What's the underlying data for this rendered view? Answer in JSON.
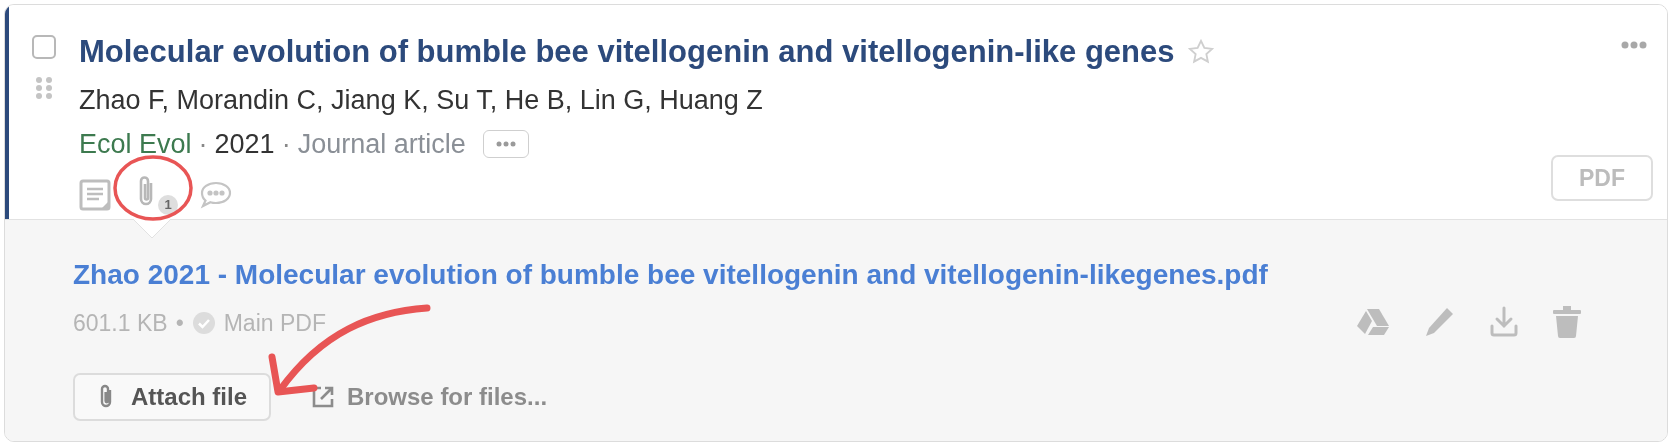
{
  "item": {
    "selected": false,
    "starred": false,
    "title": "Molecular evolution of bumble bee vitellogenin and vitellogenin-like genes",
    "authors": "Zhao F, Morandin C, Jiang K, Su T, He B, Lin G, Huang Z",
    "journal": "Ecol Evol",
    "separator_1": "·",
    "year": "2021",
    "separator_2": "·",
    "type": "Journal article",
    "attachment_count": "1",
    "pdf_button": "PDF"
  },
  "attachments": [
    {
      "file_name": "Zhao 2021 - Molecular evolution of bumble bee vitellogenin and vitellogenin-likegenes.pdf",
      "size": "601.1 KB",
      "separator": "•",
      "main": true,
      "main_label": "Main PDF"
    }
  ],
  "actions": {
    "attach": "Attach file",
    "browse": "Browse for files..."
  }
}
